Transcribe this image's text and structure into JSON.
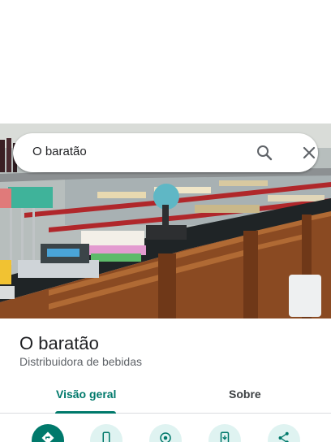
{
  "search": {
    "query": "O baratão",
    "search_icon": "search-icon",
    "close_icon": "close-icon"
  },
  "place": {
    "title": "O baratão",
    "category": "Distribuidora de bebidas"
  },
  "tabs": [
    {
      "label": "Visão geral",
      "selected": true
    },
    {
      "label": "Sobre",
      "selected": false
    }
  ],
  "actions": [
    {
      "icon": "directions-icon"
    },
    {
      "icon": "call-icon"
    },
    {
      "icon": "nearby-icon"
    },
    {
      "icon": "save-to-phone-icon"
    },
    {
      "icon": "share-icon"
    }
  ],
  "colors": {
    "accent": "#00796b",
    "action_bg": "#dff3f1",
    "secondary_text": "#5f6368"
  }
}
